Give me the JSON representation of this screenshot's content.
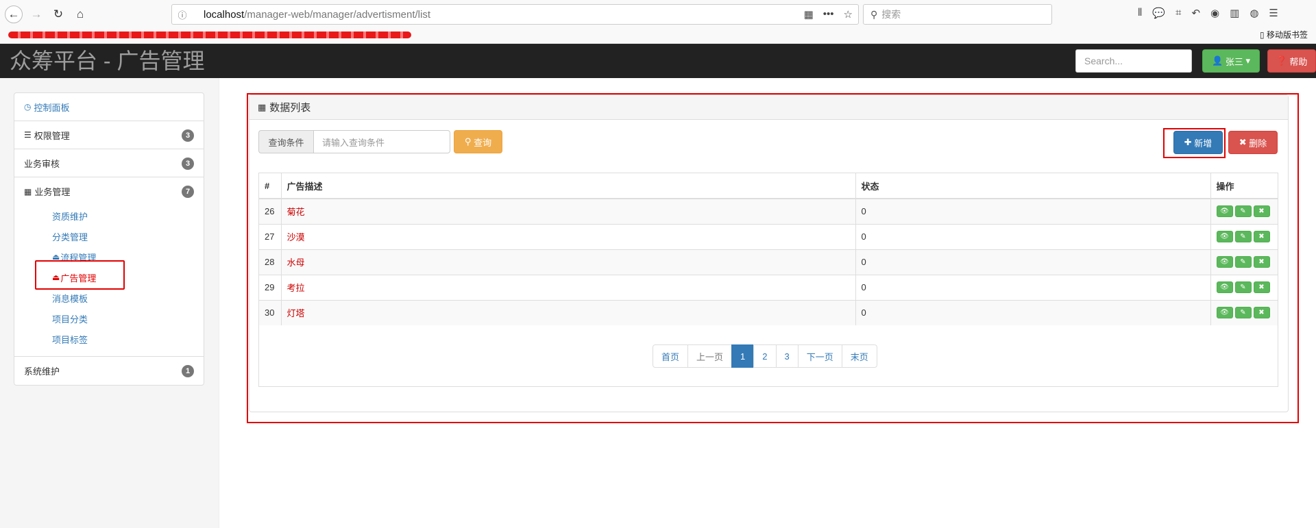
{
  "browser": {
    "url_host": "localhost",
    "url_path": "/manager-web/manager/advertisment/list",
    "search_placeholder": "搜索",
    "mobile_bookmarks": "移动版书签"
  },
  "app": {
    "brand": "众筹平台 - 广告管理",
    "search_placeholder": "Search...",
    "user_label": "张三",
    "help_label": "帮助"
  },
  "sidebar": {
    "dashboard": "控制面板",
    "items": [
      {
        "label": "权限管理",
        "badge": "3"
      },
      {
        "label": "业务审核",
        "badge": "3"
      },
      {
        "label": "业务管理",
        "badge": "7"
      },
      {
        "label": "系统维护",
        "badge": "1"
      }
    ],
    "sub_items": [
      "资质维护",
      "分类管理",
      "流程管理",
      "广告管理",
      "消息模板",
      "项目分类",
      "项目标签"
    ]
  },
  "panel": {
    "title": "数据列表",
    "query_label": "查询条件",
    "query_placeholder": "请输入查询条件",
    "query_button": "查询",
    "add_button": "新增",
    "delete_button": "删除"
  },
  "table": {
    "headers": [
      "#",
      "广告描述",
      "状态",
      "操作"
    ],
    "rows": [
      {
        "id": "26",
        "desc": "菊花",
        "status": "0"
      },
      {
        "id": "27",
        "desc": "沙漠",
        "status": "0"
      },
      {
        "id": "28",
        "desc": "水母",
        "status": "0"
      },
      {
        "id": "29",
        "desc": "考拉",
        "status": "0"
      },
      {
        "id": "30",
        "desc": "灯塔",
        "status": "0"
      }
    ]
  },
  "pagination": {
    "first": "首页",
    "prev": "上一页",
    "pages": [
      "1",
      "2",
      "3"
    ],
    "next": "下一页",
    "last": "末页"
  }
}
